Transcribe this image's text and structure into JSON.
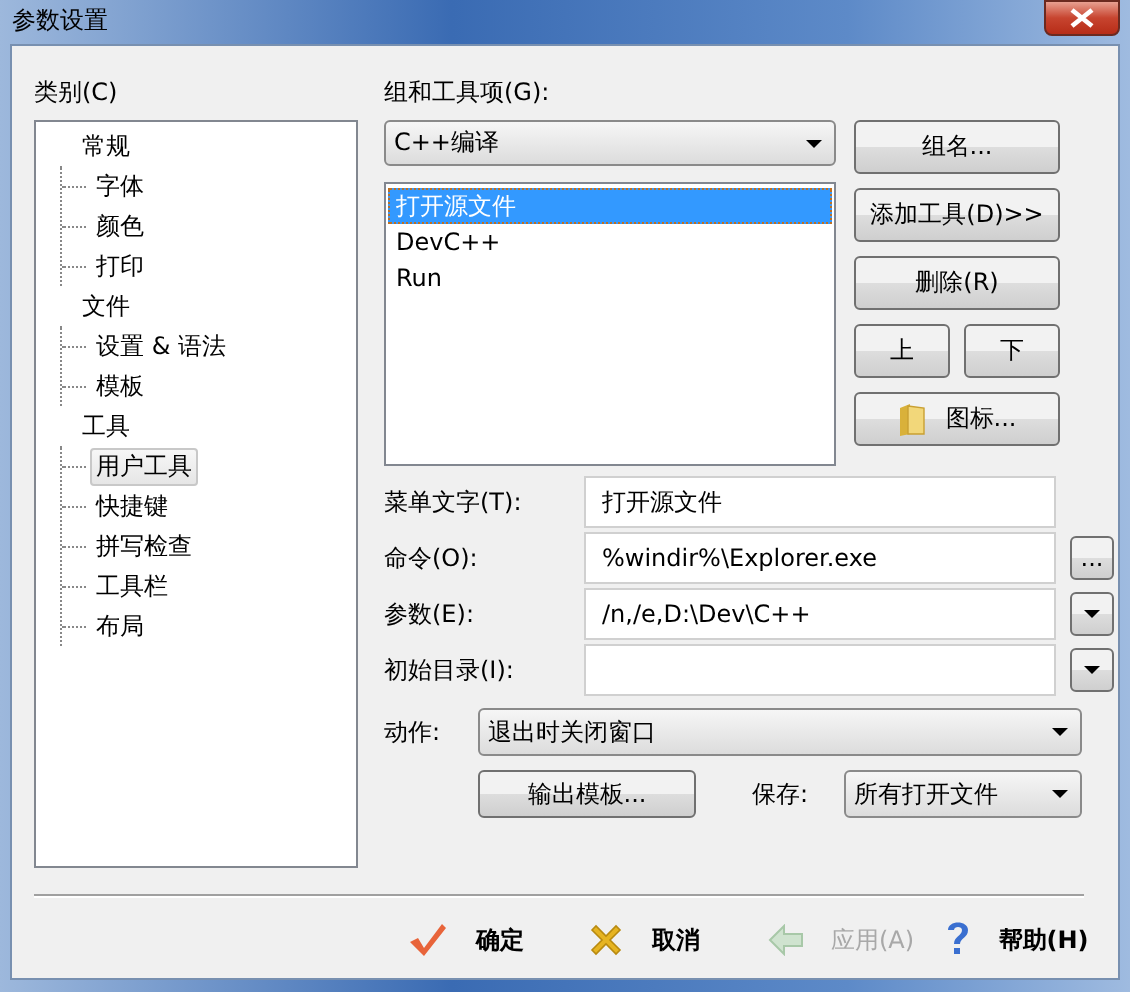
{
  "window": {
    "title": "参数设置"
  },
  "category": {
    "label": "类别(C)",
    "tree": [
      {
        "label": "常规",
        "selected": false,
        "children": [
          {
            "label": "字体",
            "selected": false
          },
          {
            "label": "颜色",
            "selected": false
          },
          {
            "label": "打印",
            "selected": false
          }
        ]
      },
      {
        "label": "文件",
        "selected": false,
        "children": [
          {
            "label": "设置 & 语法",
            "selected": false
          },
          {
            "label": "模板",
            "selected": false
          }
        ]
      },
      {
        "label": "工具",
        "selected": false,
        "children": [
          {
            "label": "用户工具",
            "selected": true
          },
          {
            "label": "快捷键",
            "selected": false
          },
          {
            "label": "拼写检查",
            "selected": false
          },
          {
            "label": "工具栏",
            "selected": false
          },
          {
            "label": "布局",
            "selected": false
          }
        ]
      }
    ]
  },
  "tools": {
    "label": "组和工具项(G):",
    "group": "C++编译",
    "items": [
      {
        "label": "打开源文件",
        "selected": true
      },
      {
        "label": "DevC++",
        "selected": false
      },
      {
        "label": "Run",
        "selected": false
      }
    ],
    "group_name_button": "组名...",
    "add_tool_button": "添加工具(D)>>",
    "delete_button": "删除(R)",
    "up_button": "上",
    "down_button": "下",
    "icon_button": "图标..."
  },
  "fields": [
    {
      "kind": "text",
      "label": "菜单文字(T):",
      "value": "打开源文件"
    },
    {
      "kind": "browse",
      "label": "命令(O):",
      "value": "%windir%\\Explorer.exe",
      "button": "..."
    },
    {
      "kind": "dropdown",
      "label": "参数(E):",
      "value": "/n,/e,D:\\Dev\\C++"
    },
    {
      "kind": "dropdown",
      "label": "初始目录(I):"
    }
  ],
  "action": {
    "label": "动作:",
    "value": "退出时关闭窗口"
  },
  "export_button": "输出模板...",
  "save": {
    "label": "保存:",
    "value": "所有打开文件"
  },
  "footer": [
    {
      "kind": "ok",
      "label": "确定",
      "disabled": false
    },
    {
      "kind": "cancel",
      "label": "取消",
      "disabled": false
    },
    {
      "kind": "apply",
      "label": "应用(A)",
      "disabled": true
    },
    {
      "kind": "help",
      "label": "帮助(H)",
      "disabled": false
    }
  ]
}
